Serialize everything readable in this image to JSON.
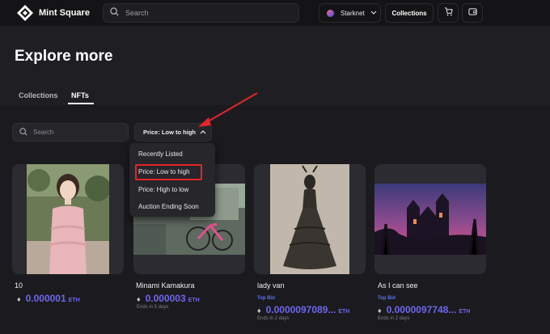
{
  "app": {
    "brand_name": "Mint Square"
  },
  "topbar": {
    "search_placeholder": "Search",
    "chain_label": "Starknet",
    "collections_label": "Collections"
  },
  "header": {
    "title": "Explore more",
    "tabs": [
      {
        "label": "Collections",
        "active": false
      },
      {
        "label": "NFTs",
        "active": true
      }
    ]
  },
  "filters": {
    "search_placeholder": "Search",
    "sort_label": "Price: Low to high"
  },
  "sort_menu": {
    "items": [
      {
        "label": "Recently Listed"
      },
      {
        "label": "Price: Low to high",
        "selected": true
      },
      {
        "label": "Price: High to low"
      },
      {
        "label": "Auction Ending Soon"
      }
    ]
  },
  "nfts": [
    {
      "name": "10",
      "price": "0.000001",
      "unit": "ETH"
    },
    {
      "name": "Minami Kamakura",
      "price": "0.000003",
      "unit": "ETH",
      "ends": "Ends in 5 days"
    },
    {
      "name": "lady van",
      "top_bid_label": "Top Bid",
      "price": "0.0000097089...",
      "unit": "ETH",
      "ends": "Ends in 2 days"
    },
    {
      "name": "As I can see",
      "top_bid_label": "Top Bid",
      "price": "0.0000097748...",
      "unit": "ETH",
      "ends": "Ends in 2 days"
    }
  ],
  "colors": {
    "accent": "#6f66ee",
    "highlight_box": "#e3262b",
    "background": "#1b1b1f"
  }
}
